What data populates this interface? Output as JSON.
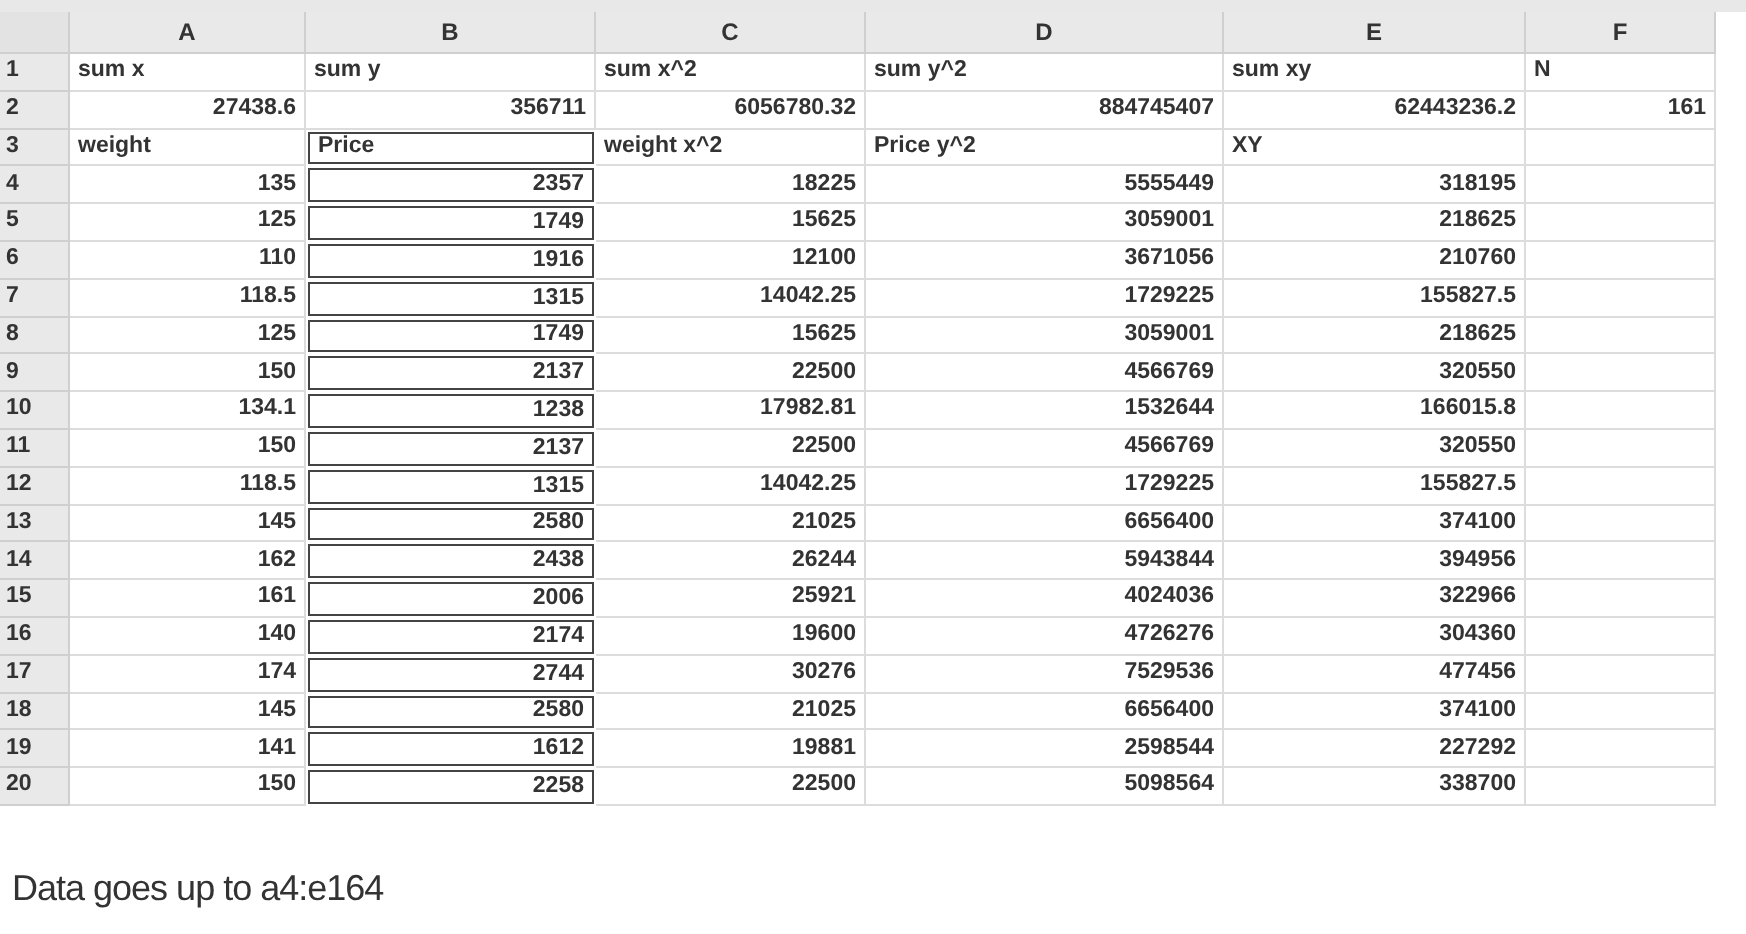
{
  "columns": [
    {
      "label": "A",
      "boxed": false
    },
    {
      "label": "B",
      "boxed": true
    },
    {
      "label": "C",
      "boxed": false
    },
    {
      "label": "D",
      "boxed": false
    },
    {
      "label": "E",
      "boxed": false
    },
    {
      "label": "F",
      "boxed": false
    }
  ],
  "rows": [
    {
      "header": "1",
      "kind": "labels",
      "boxed": false,
      "cells": [
        "sum x",
        "sum y",
        "sum x^2",
        "sum y^2",
        "sum xy",
        "N"
      ]
    },
    {
      "header": "2",
      "kind": "values",
      "boxed": false,
      "cells": [
        "27438.6",
        "356711",
        "6056780.32",
        "884745407",
        "62443236.2",
        "161"
      ]
    },
    {
      "header": "3",
      "kind": "labels",
      "boxed": true,
      "cells": [
        "weight",
        "Price",
        "weight x^2",
        "Price y^2",
        "XY"
      ]
    },
    {
      "header": "4",
      "kind": "values",
      "boxed": true,
      "cells": [
        "135",
        "2357",
        "18225",
        "5555449",
        "318195"
      ]
    },
    {
      "header": "5",
      "kind": "values",
      "boxed": true,
      "cells": [
        "125",
        "1749",
        "15625",
        "3059001",
        "218625"
      ]
    },
    {
      "header": "6",
      "kind": "values",
      "boxed": true,
      "cells": [
        "110",
        "1916",
        "12100",
        "3671056",
        "210760"
      ]
    },
    {
      "header": "7",
      "kind": "values",
      "boxed": true,
      "cells": [
        "118.5",
        "1315",
        "14042.25",
        "1729225",
        "155827.5"
      ]
    },
    {
      "header": "8",
      "kind": "values",
      "boxed": true,
      "cells": [
        "125",
        "1749",
        "15625",
        "3059001",
        "218625"
      ]
    },
    {
      "header": "9",
      "kind": "values",
      "boxed": true,
      "cells": [
        "150",
        "2137",
        "22500",
        "4566769",
        "320550"
      ]
    },
    {
      "header": "10",
      "kind": "values",
      "boxed": true,
      "cells": [
        "134.1",
        "1238",
        "17982.81",
        "1532644",
        "166015.8"
      ]
    },
    {
      "header": "11",
      "kind": "values",
      "boxed": true,
      "cells": [
        "150",
        "2137",
        "22500",
        "4566769",
        "320550"
      ]
    },
    {
      "header": "12",
      "kind": "values",
      "boxed": true,
      "cells": [
        "118.5",
        "1315",
        "14042.25",
        "1729225",
        "155827.5"
      ]
    },
    {
      "header": "13",
      "kind": "values",
      "boxed": true,
      "cells": [
        "145",
        "2580",
        "21025",
        "6656400",
        "374100"
      ]
    },
    {
      "header": "14",
      "kind": "values",
      "boxed": true,
      "cells": [
        "162",
        "2438",
        "26244",
        "5943844",
        "394956"
      ]
    },
    {
      "header": "15",
      "kind": "values",
      "boxed": true,
      "cells": [
        "161",
        "2006",
        "25921",
        "4024036",
        "322966"
      ]
    },
    {
      "header": "16",
      "kind": "values",
      "boxed": true,
      "cells": [
        "140",
        "2174",
        "19600",
        "4726276",
        "304360"
      ]
    },
    {
      "header": "17",
      "kind": "values",
      "boxed": true,
      "cells": [
        "174",
        "2744",
        "30276",
        "7529536",
        "477456"
      ]
    },
    {
      "header": "18",
      "kind": "values",
      "boxed": true,
      "cells": [
        "145",
        "2580",
        "21025",
        "6656400",
        "374100"
      ]
    },
    {
      "header": "19",
      "kind": "values",
      "boxed": true,
      "cells": [
        "141",
        "1612",
        "19881",
        "2598544",
        "227292"
      ]
    },
    {
      "header": "20",
      "kind": "values",
      "boxed": true,
      "cells": [
        "150",
        "2258",
        "22500",
        "5098564",
        "338700"
      ]
    }
  ],
  "note": "Data goes up to a4:e164"
}
